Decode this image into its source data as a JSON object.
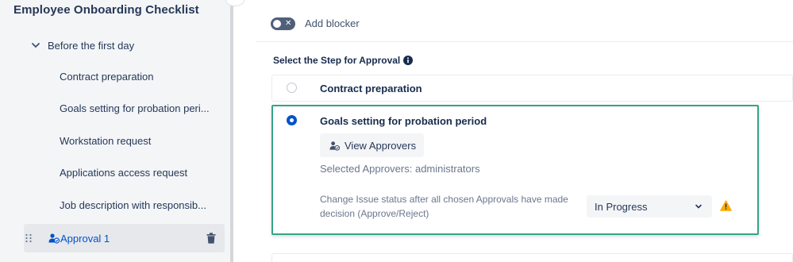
{
  "sidebar": {
    "title": "Employee Onboarding Checklist",
    "section": {
      "label": "Before the first day",
      "icon": "chevron-down-icon"
    },
    "items": [
      {
        "label": "Contract preparation"
      },
      {
        "label": "Goals setting for probation peri..."
      },
      {
        "label": "Workstation request"
      },
      {
        "label": "Applications access request"
      },
      {
        "label": "Job description with responsib..."
      }
    ],
    "active_item": {
      "label": "Approval 1",
      "icon": "approvers-icon",
      "action_icon": "trash-icon"
    }
  },
  "main": {
    "blocker_toggle": {
      "label": "Add blocker",
      "state": "off"
    },
    "step_heading": "Select the Step for Approval",
    "options": [
      {
        "label": "Contract preparation",
        "selected": false
      },
      {
        "label": "Goals setting for probation period",
        "selected": true
      }
    ],
    "view_approvers_label": "View Approvers",
    "selected_approvers_text": "Selected Approvers: administrators",
    "change_status_text": "Change Issue status after all chosen Approvals have made decision (Approve/Reject)",
    "status_select": {
      "value": "In Progress"
    }
  },
  "colors": {
    "accent": "#0052cc",
    "selected_border": "#36a386",
    "warning": "#ffab00",
    "sidebar_bg": "#f4f5f7"
  }
}
